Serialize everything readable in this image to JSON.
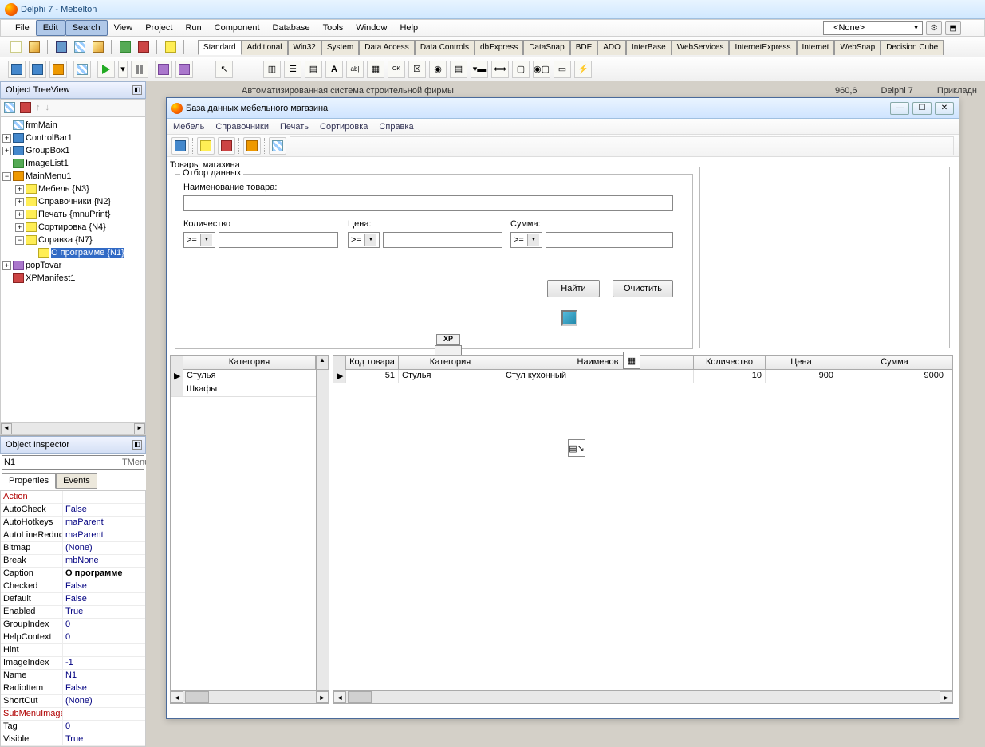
{
  "app": {
    "title": "Delphi 7 - Mebelton"
  },
  "menu": {
    "items": [
      "File",
      "Edit",
      "Search",
      "View",
      "Project",
      "Run",
      "Component",
      "Database",
      "Tools",
      "Window",
      "Help"
    ],
    "active_index": [
      1,
      2
    ],
    "dropdown_value": "<None>"
  },
  "palette_tabs": [
    "Standard",
    "Additional",
    "Win32",
    "System",
    "Data Access",
    "Data Controls",
    "dbExpress",
    "DataSnap",
    "BDE",
    "ADO",
    "InterBase",
    "WebServices",
    "InternetExpress",
    "Internet",
    "WebSnap",
    "Decision Cube"
  ],
  "treeview": {
    "title": "Object TreeView",
    "nodes": [
      {
        "indent": 0,
        "icon": "form",
        "label": "frmMain",
        "toggle": null
      },
      {
        "indent": 0,
        "icon": "ctl",
        "label": "ControlBar1",
        "toggle": "+"
      },
      {
        "indent": 0,
        "icon": "ctl",
        "label": "GroupBox1",
        "toggle": "+"
      },
      {
        "indent": 0,
        "icon": "img",
        "label": "ImageList1",
        "toggle": null
      },
      {
        "indent": 0,
        "icon": "menu",
        "label": "MainMenu1",
        "toggle": "-"
      },
      {
        "indent": 1,
        "icon": "mi",
        "label": "Мебель {N3}",
        "toggle": "+"
      },
      {
        "indent": 1,
        "icon": "mi",
        "label": "Справочники {N2}",
        "toggle": "+"
      },
      {
        "indent": 1,
        "icon": "mi",
        "label": "Печать {mnuPrint}",
        "toggle": "+"
      },
      {
        "indent": 1,
        "icon": "mi",
        "label": "Сортировка {N4}",
        "toggle": "+"
      },
      {
        "indent": 1,
        "icon": "mi",
        "label": "Справка {N7}",
        "toggle": "-"
      },
      {
        "indent": 2,
        "icon": "mi",
        "label": "О программе {N1}",
        "toggle": null,
        "selected": true
      },
      {
        "indent": 0,
        "icon": "pop",
        "label": "popTovar",
        "toggle": "+"
      },
      {
        "indent": 0,
        "icon": "xp",
        "label": "XPManifest1",
        "toggle": null
      }
    ]
  },
  "inspector": {
    "title": "Object Inspector",
    "selected_name": "N1",
    "selected_type": "TMenuItem",
    "tabs": [
      "Properties",
      "Events"
    ],
    "active_tab": 0,
    "props": [
      {
        "name": "Action",
        "value": "",
        "red": true
      },
      {
        "name": "AutoCheck",
        "value": "False"
      },
      {
        "name": "AutoHotkeys",
        "value": "maParent"
      },
      {
        "name": "AutoLineReduc",
        "value": "maParent"
      },
      {
        "name": "Bitmap",
        "value": "(None)"
      },
      {
        "name": "Break",
        "value": "mbNone"
      },
      {
        "name": "Caption",
        "value": "О программе",
        "selected": true
      },
      {
        "name": "Checked",
        "value": "False"
      },
      {
        "name": "Default",
        "value": "False"
      },
      {
        "name": "Enabled",
        "value": "True"
      },
      {
        "name": "GroupIndex",
        "value": "0"
      },
      {
        "name": "HelpContext",
        "value": "0"
      },
      {
        "name": "Hint",
        "value": ""
      },
      {
        "name": "ImageIndex",
        "value": "-1"
      },
      {
        "name": "Name",
        "value": "N1"
      },
      {
        "name": "RadioItem",
        "value": "False"
      },
      {
        "name": "ShortCut",
        "value": "(None)"
      },
      {
        "name": "SubMenuImage",
        "value": "",
        "red": true
      },
      {
        "name": "Tag",
        "value": "0"
      },
      {
        "name": "Visible",
        "value": "True"
      }
    ]
  },
  "background_status": {
    "title": "Автоматизированная система строительной фирмы",
    "num": "960,6",
    "ide": "Delphi 7",
    "kind": "Прикладн"
  },
  "form": {
    "title": "База данных мебельного магазина",
    "menu": [
      "Мебель",
      "Справочники",
      "Печать",
      "Сортировка",
      "Справка"
    ],
    "groupbox_outer": "Товары магазина",
    "groupbox_filter": "Отбор данных",
    "labels": {
      "name": "Наименование товара:",
      "qty": "Количество",
      "price": "Цена:",
      "sum": "Сумма:",
      "op": ">="
    },
    "buttons": {
      "find": "Найти",
      "clear": "Очистить"
    },
    "xp_label": "XP",
    "categories_grid": {
      "header": "Категория",
      "rows": [
        "Стулья",
        "Шкафы"
      ]
    },
    "data_grid": {
      "headers": [
        "Код товара",
        "Категория",
        "Наименов",
        "Количество",
        "Цена",
        "Сумма"
      ],
      "row": {
        "code": "51",
        "cat": "Стулья",
        "name": "Стул кухонный",
        "qty": "10",
        "price": "900",
        "sum": "9000"
      }
    }
  }
}
